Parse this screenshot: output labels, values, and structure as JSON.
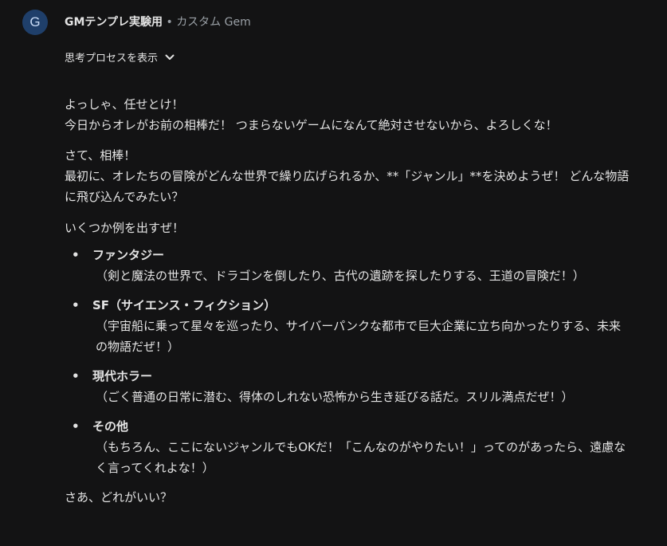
{
  "header": {
    "avatar_letter": "G",
    "gem_name": "GMテンプレ実験用",
    "separator": " • ",
    "gem_type": "カスタム Gem"
  },
  "thinking": {
    "label": "思考プロセスを表示",
    "icon": "chevron-down-icon"
  },
  "message": {
    "p1_line1": "よっしゃ、任せとけ！",
    "p1_line2": "今日からオレがお前の相棒だ！ つまらないゲームになんて絶対させないから、よろしくな！",
    "p2_line1": "さて、相棒！",
    "p2_line2": "最初に、オレたちの冒険がどんな世界で繰り広げられるか、**「ジャンル」**を決めようぜ！ どんな物語に飛び込んでみたい？",
    "p3": "いくつか例を出すぜ！",
    "genres": [
      {
        "title": "ファンタジー",
        "desc": "（剣と魔法の世界で、ドラゴンを倒したり、古代の遺跡を探したりする、王道の冒険だ！）"
      },
      {
        "title": "SF（サイエンス・フィクション）",
        "desc": "（宇宙船に乗って星々を巡ったり、サイバーパンクな都市で巨大企業に立ち向かったりする、未来の物語だぜ！）"
      },
      {
        "title": "現代ホラー",
        "desc": "（ごく普通の日常に潜む、得体のしれない恐怖から生き延びる話だ。スリル満点だぜ！）"
      },
      {
        "title": "その他",
        "desc": "（もちろん、ここにないジャンルでもOKだ！「こんなのがやりたい！」ってのがあったら、遠慮なく言ってくれよな！）"
      }
    ],
    "bullet": "•",
    "closing": "さあ、どれがいい？"
  },
  "colors": {
    "background": "#131314",
    "text": "#e3e3e3",
    "muted": "#9aa0a6",
    "avatar_bg": "#1f3f6a"
  }
}
